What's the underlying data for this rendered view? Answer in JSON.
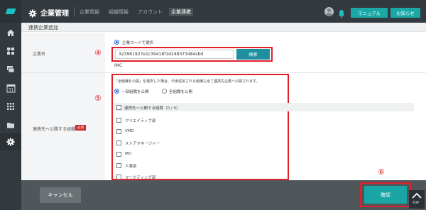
{
  "header": {
    "title": "企業管理",
    "tabs": [
      {
        "label": "企業情報"
      },
      {
        "label": "組織情報"
      },
      {
        "label": "アカウント"
      },
      {
        "label": "企業連携"
      }
    ],
    "manual_label": "マニュアル",
    "notice_label": "お知らせ"
  },
  "sidebar": {
    "items": [
      {
        "icon": "home-icon"
      },
      {
        "icon": "organization-icon"
      },
      {
        "icon": "stack-icon"
      },
      {
        "icon": "calendar-icon",
        "label": "31"
      },
      {
        "icon": "grid-icon"
      },
      {
        "icon": "folder-icon"
      },
      {
        "icon": "gear-icon"
      }
    ]
  },
  "section": {
    "title": "連携企業追加"
  },
  "company": {
    "label": "企業名",
    "radio_label": "企業コードで選択",
    "code_value": "323961927e1c39418f1d248373484sbd",
    "search_label": "検索",
    "result_name": "IMC",
    "annotation": "④"
  },
  "publish": {
    "label": "連携先へ公開する組織",
    "required_label": "必須",
    "note": "「全組織を公開」を選択した場合、今後追加される組織も全て連携先企業へ公開されます。",
    "option_partial": "一部組織を公開",
    "option_all": "全組織を公開",
    "list_header": "連携先へ公開する組織（0 / 9）",
    "orgs": [
      {
        "name": "クリエイティブ部"
      },
      {
        "name": "VMD"
      },
      {
        "name": "ストアマネージャー"
      },
      {
        "name": "MD"
      },
      {
        "name": "人事部"
      },
      {
        "name": "マーケティング部"
      }
    ],
    "annotation": "⑤"
  },
  "footer": {
    "cancel_label": "キャンセル",
    "confirm_label": "確認",
    "confirm_annotation": "⑥",
    "top_label": "TOP"
  },
  "colors": {
    "accent": "#19a8a6",
    "header_bg": "#333a3f",
    "annotation_red": "#e0202a"
  }
}
